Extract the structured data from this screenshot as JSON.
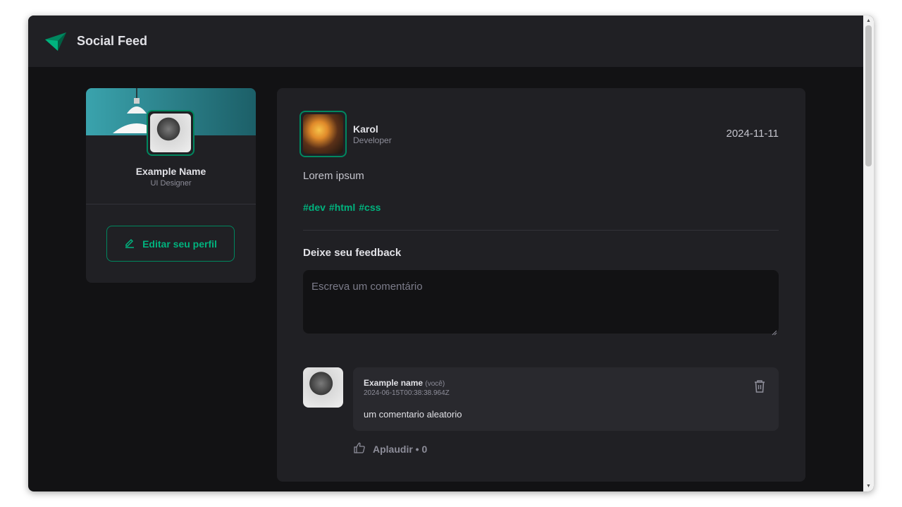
{
  "header": {
    "app_title": "Social Feed",
    "logo_icon": "paper-plane-icon",
    "accent": "#00b37e"
  },
  "sidebar": {
    "name": "Example Name",
    "role": "UI Designer",
    "edit_button_label": "Editar seu perfil",
    "edit_icon": "pencil-icon"
  },
  "post": {
    "author": {
      "name": "Karol",
      "role": "Developer"
    },
    "date": "2024-11-11",
    "content": "Lorem ipsum",
    "tags": [
      "#dev",
      "#html",
      "#css"
    ],
    "feedback_title": "Deixe seu feedback",
    "comment_placeholder": "Escreva um comentário",
    "comments": [
      {
        "author": "Example name",
        "author_suffix": "(você)",
        "timestamp": "2024-06-15T00:38:38.964Z",
        "text": "um comentario aleatorio",
        "applaud_label": "Aplaudir",
        "applaud_separator": "•",
        "applaud_count": "0"
      }
    ]
  },
  "colors": {
    "background": "#121214",
    "card": "#202024",
    "comment_card": "#29292e",
    "accent_border": "#00875f",
    "text_primary": "#e1e1e6",
    "text_secondary": "#8d8d99"
  }
}
